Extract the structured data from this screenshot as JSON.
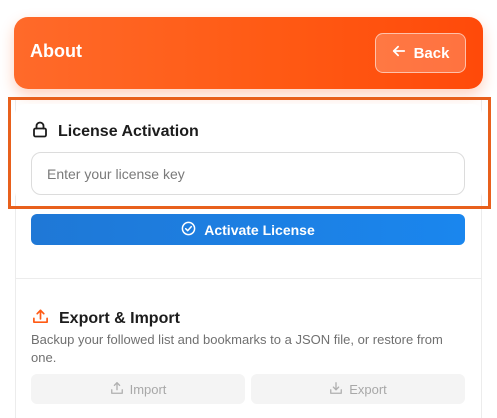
{
  "header": {
    "title": "About",
    "back_label": "Back",
    "gradient_colors": [
      "#ff6a2a",
      "#ff4a0a"
    ]
  },
  "license": {
    "title": "License Activation",
    "input_placeholder": "Enter your license key",
    "input_value": "",
    "activate_label": "Activate License",
    "activate_color": "#1a86ee",
    "highlight_color": "#e8601c"
  },
  "export_import": {
    "title": "Export & Import",
    "description": "Backup your followed list and bookmarks to a JSON file, or restore from one.",
    "import_label": "Import",
    "export_label": "Export",
    "accent_color": "#ff5a14"
  }
}
